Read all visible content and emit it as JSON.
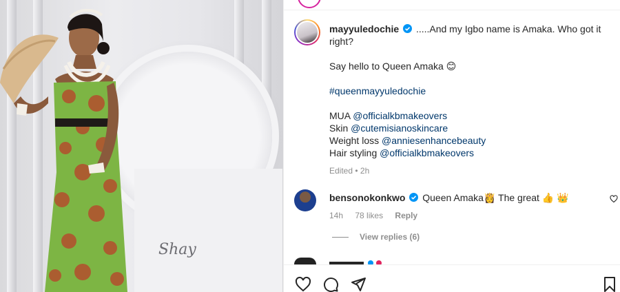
{
  "post": {
    "username": "mayyuledochie",
    "caption_line1": ".....And my Igbo name is Amaka. Who got it right?",
    "caption_line2": "Say hello to Queen Amaka 😊",
    "hashtag": "#queenmayyuledochie",
    "credits": [
      {
        "label": "MUA",
        "handle": "@officialkbmakeovers"
      },
      {
        "label": "Skin",
        "handle": "@cutemisianoskincare"
      },
      {
        "label": "Weight loss",
        "handle": "@anniesenhancebeauty"
      },
      {
        "label": "Hair styling",
        "handle": "@officialkbmakeovers"
      }
    ],
    "meta": "Edited • 2h"
  },
  "comment": {
    "username": "bensonokonkwo",
    "text": "Queen Amaka👸 The great 👍 👑",
    "time": "14h",
    "likes": "78 likes",
    "reply": "Reply"
  },
  "view_replies": "View replies (6)",
  "watermark": "Shay",
  "colors": {
    "link": "#00376b",
    "verified": "#0095f6",
    "muted": "#8e8e8e"
  },
  "icons": [
    "heart-icon",
    "comment-icon",
    "share-icon",
    "bookmark-icon",
    "verified-badge-icon"
  ]
}
